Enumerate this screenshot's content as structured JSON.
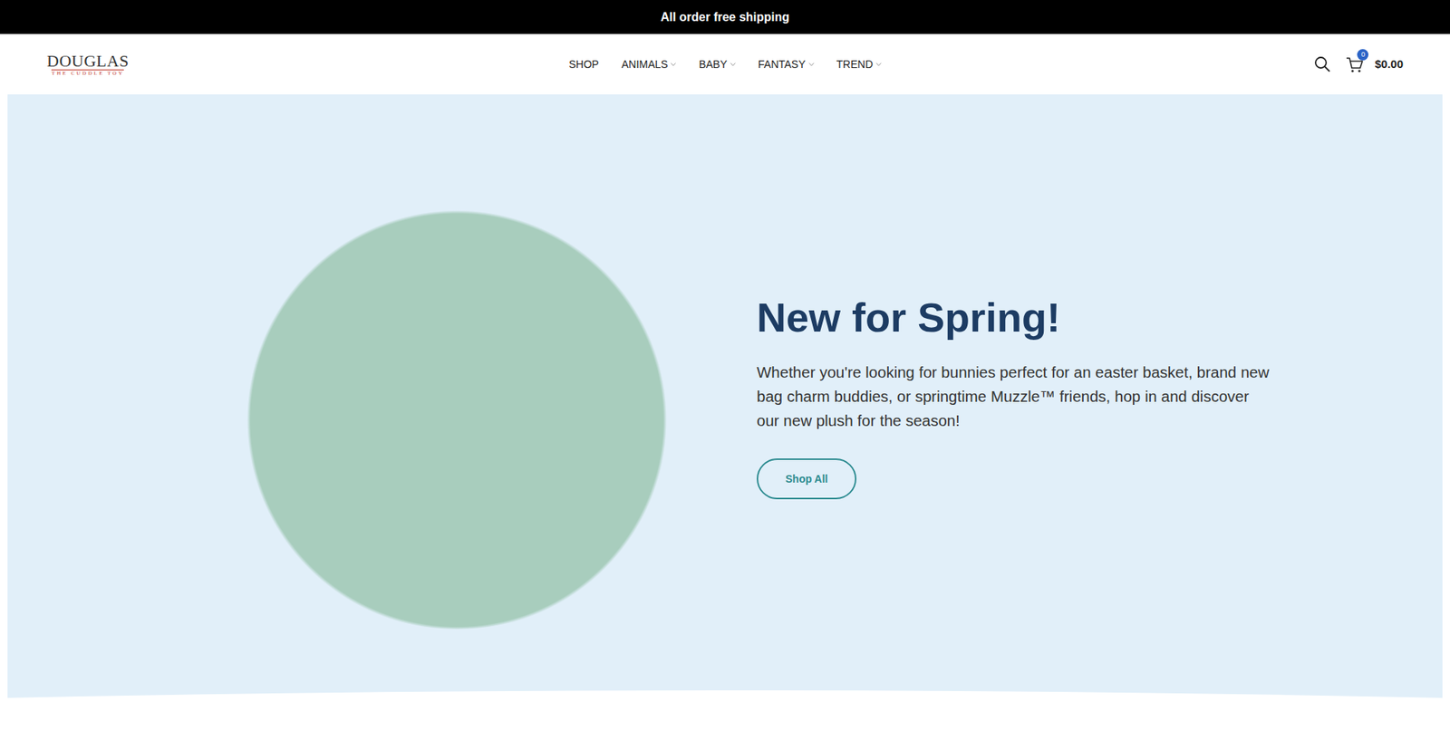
{
  "announcement": "All order free shipping",
  "logo": {
    "name": "DOUGLAS",
    "tagline": "THE CUDDLE TOY"
  },
  "nav": [
    {
      "label": "SHOP",
      "dropdown": false
    },
    {
      "label": "ANIMALS",
      "dropdown": true
    },
    {
      "label": "BABY",
      "dropdown": true
    },
    {
      "label": "FANTASY",
      "dropdown": true
    },
    {
      "label": "TREND",
      "dropdown": true
    }
  ],
  "cart": {
    "count": "0",
    "total": "$0.00"
  },
  "hero": {
    "title": "New for Spring!",
    "text": "Whether you're looking for bunnies perfect for an easter basket, brand new bag charm buddies, or springtime Muzzle™ friends, hop in and discover our new plush for the season!",
    "button": "Shop All"
  }
}
